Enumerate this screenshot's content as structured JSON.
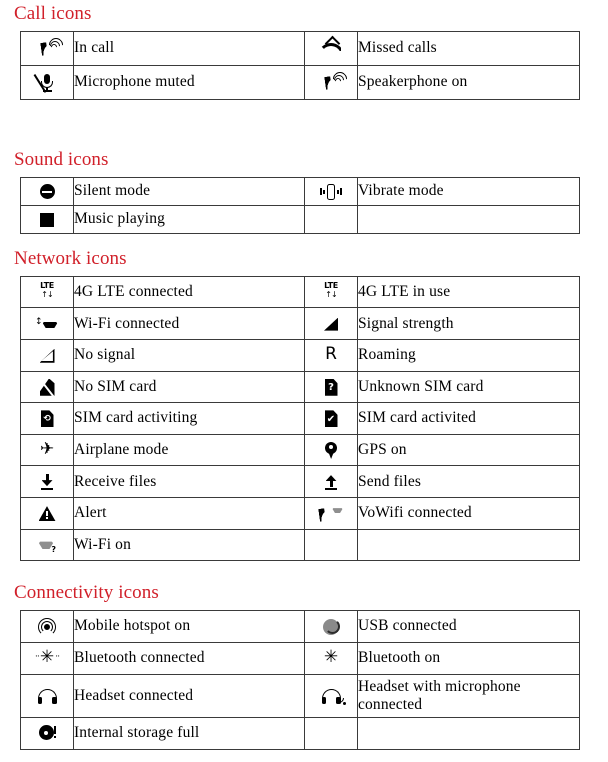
{
  "sections": [
    {
      "id": "call",
      "heading": "Call icons",
      "rows": [
        {
          "left": {
            "icon": "in-call-icon",
            "label": "In call"
          },
          "right": {
            "icon": "missed-calls-icon",
            "label": "Missed calls"
          }
        },
        {
          "left": {
            "icon": "microphone-muted-icon",
            "label": "Microphone muted"
          },
          "right": {
            "icon": "speakerphone-on-icon",
            "label": "Speakerphone on"
          }
        }
      ]
    },
    {
      "id": "sound",
      "heading": "Sound icons",
      "rows": [
        {
          "left": {
            "icon": "silent-mode-icon",
            "label": "Silent mode"
          },
          "right": {
            "icon": "vibrate-mode-icon",
            "label": "Vibrate mode"
          }
        },
        {
          "left": {
            "icon": "music-playing-icon",
            "label": "Music playing"
          },
          "right": {
            "icon": "",
            "label": ""
          }
        }
      ]
    },
    {
      "id": "network",
      "heading": "Network icons",
      "rows": [
        {
          "left": {
            "icon": "4g-lte-connected-icon",
            "label": "4G LTE connected"
          },
          "right": {
            "icon": "4g-lte-in-use-icon",
            "label": "4G LTE in use"
          }
        },
        {
          "left": {
            "icon": "wifi-connected-icon",
            "label": "Wi-Fi connected"
          },
          "right": {
            "icon": "signal-strength-icon",
            "label": "Signal strength"
          }
        },
        {
          "left": {
            "icon": "no-signal-icon",
            "label": "No signal"
          },
          "right": {
            "icon": "roaming-icon",
            "label": "Roaming"
          }
        },
        {
          "left": {
            "icon": "no-sim-card-icon",
            "label": "No SIM card"
          },
          "right": {
            "icon": "unknown-sim-card-icon",
            "label": "Unknown SIM card"
          }
        },
        {
          "left": {
            "icon": "sim-card-activating-icon",
            "label": "SIM card activiting"
          },
          "right": {
            "icon": "sim-card-activated-icon",
            "label": "SIM card activited"
          }
        },
        {
          "left": {
            "icon": "airplane-mode-icon",
            "label": "Airplane mode"
          },
          "right": {
            "icon": "gps-on-icon",
            "label": "GPS on"
          }
        },
        {
          "left": {
            "icon": "receive-files-icon",
            "label": "Receive files"
          },
          "right": {
            "icon": "send-files-icon",
            "label": "Send files"
          }
        },
        {
          "left": {
            "icon": "alert-icon",
            "label": "Alert"
          },
          "right": {
            "icon": "vowifi-connected-icon",
            "label": "VoWifi connected"
          }
        },
        {
          "left": {
            "icon": "wifi-on-icon",
            "label": "Wi-Fi on"
          },
          "right": {
            "icon": "",
            "label": ""
          }
        }
      ]
    },
    {
      "id": "connectivity",
      "heading": "Connectivity icons",
      "rows": [
        {
          "left": {
            "icon": "mobile-hotspot-on-icon",
            "label": "Mobile hotspot on"
          },
          "right": {
            "icon": "usb-connected-icon",
            "label": "USB connected"
          }
        },
        {
          "left": {
            "icon": "bluetooth-connected-icon",
            "label": "Bluetooth connected"
          },
          "right": {
            "icon": "bluetooth-on-icon",
            "label": "Bluetooth on"
          }
        },
        {
          "left": {
            "icon": "headset-connected-icon",
            "label": "Headset connected"
          },
          "right": {
            "icon": "headset-with-microphone-icon",
            "label": "Headset with microphone connected"
          }
        },
        {
          "left": {
            "icon": "internal-storage-full-icon",
            "label": "Internal storage full"
          },
          "right": {
            "icon": "",
            "label": ""
          }
        }
      ]
    }
  ],
  "glyphs": {
    "lte_text": "LTE",
    "lte_arrows": "↑↓",
    "roaming_letter": "R",
    "airplane": "✈",
    "bluetooth": "✳",
    "sim_unknown_mark": "?",
    "sim_activated_mark": "✔",
    "wifi_connected_arrows": "↕",
    "wifi_on_mark": "?"
  },
  "colors": {
    "heading": "#d1202a",
    "text": "#000000",
    "border": "#3a3a3a",
    "background": "#ffffff",
    "usb_fill": "#8a8a8a"
  }
}
